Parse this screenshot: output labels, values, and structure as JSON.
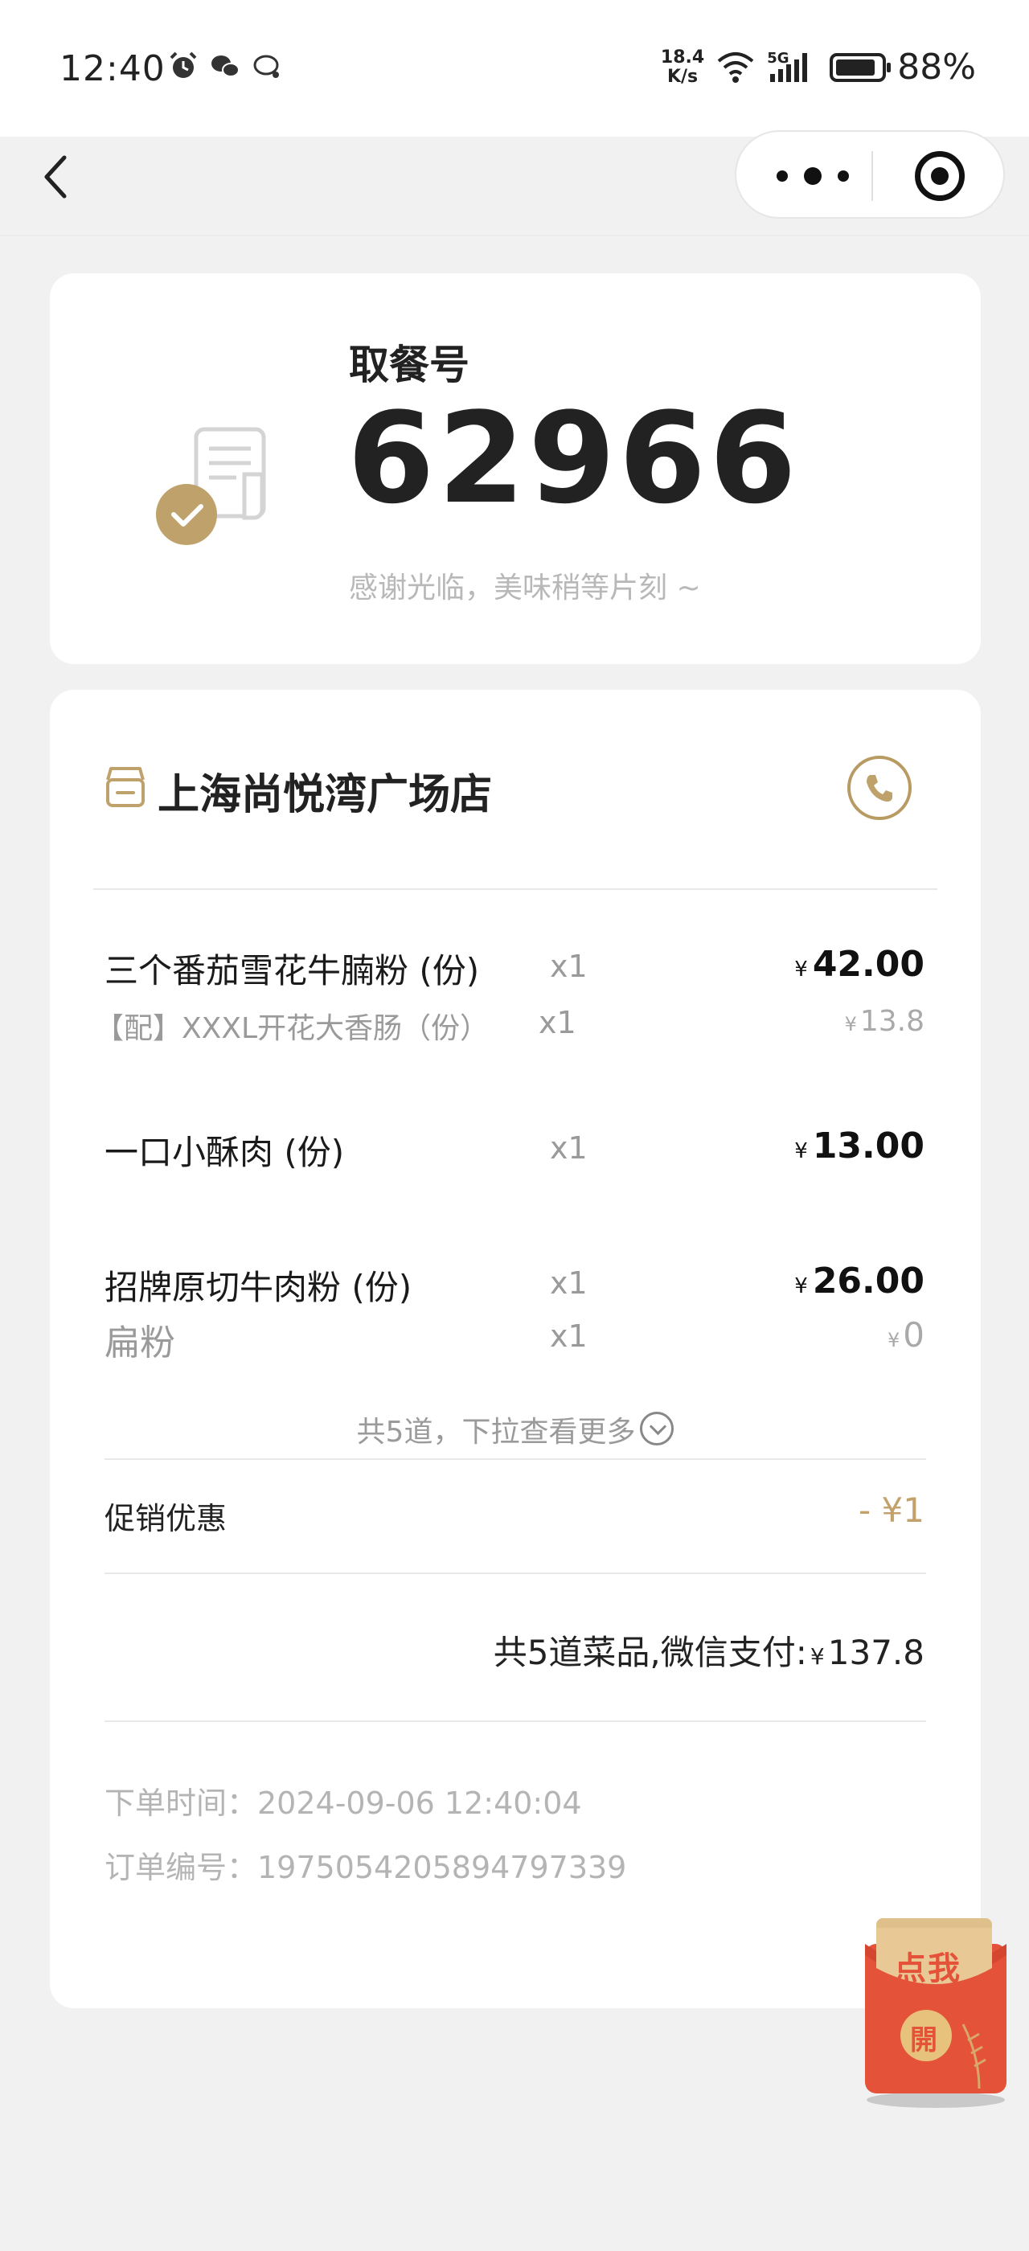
{
  "status_bar": {
    "time": "12:40",
    "net_speed_value": "18.4",
    "net_speed_unit": "K/s",
    "signal_label": "5G",
    "battery_percent": "88%",
    "battery_level": 0.88
  },
  "nav": {
    "back_icon": "chevron-left-icon",
    "more_icon": "more-dots-icon",
    "close_icon": "target-circle-icon"
  },
  "pickup": {
    "label": "取餐号",
    "number": "62966",
    "tip": "感谢光临，美味稍等片刻 ~"
  },
  "store": {
    "name": "上海尚悦湾广场店",
    "icon": "store-icon",
    "phone_icon": "phone-icon"
  },
  "items": [
    {
      "name": "三个番茄雪花牛腩粉 (份)",
      "qty": "x1",
      "currency": "¥",
      "price": "42.00",
      "sub": {
        "name": "【配】XXXL开花大香肠（份）",
        "qty": "x1",
        "currency": "¥",
        "price": "13.8"
      }
    },
    {
      "name": "一口小酥肉 (份)",
      "qty": "x1",
      "currency": "¥",
      "price": "13.00"
    },
    {
      "name": "招牌原切牛肉粉 (份)",
      "qty": "x1",
      "currency": "¥",
      "price": "26.00",
      "sub": {
        "name": "扁粉",
        "qty": "x1",
        "currency": "¥",
        "price": "0"
      }
    }
  ],
  "more_text": "共5道，下拉查看更多",
  "promo": {
    "label": "促销优惠",
    "value": "- ¥1"
  },
  "total": {
    "prefix": "共5道菜品,微信支付:",
    "currency": "¥",
    "amount": "137.8"
  },
  "meta": {
    "order_time": "下单时间：2024-09-06 12:40:04",
    "order_no": "订单编号：1975054205894797339"
  },
  "envelope": {
    "label": "点我",
    "open": "開"
  },
  "colors": {
    "accent": "#b89a63",
    "envelope_red": "#e5523a",
    "background": "#f1f1f1"
  }
}
